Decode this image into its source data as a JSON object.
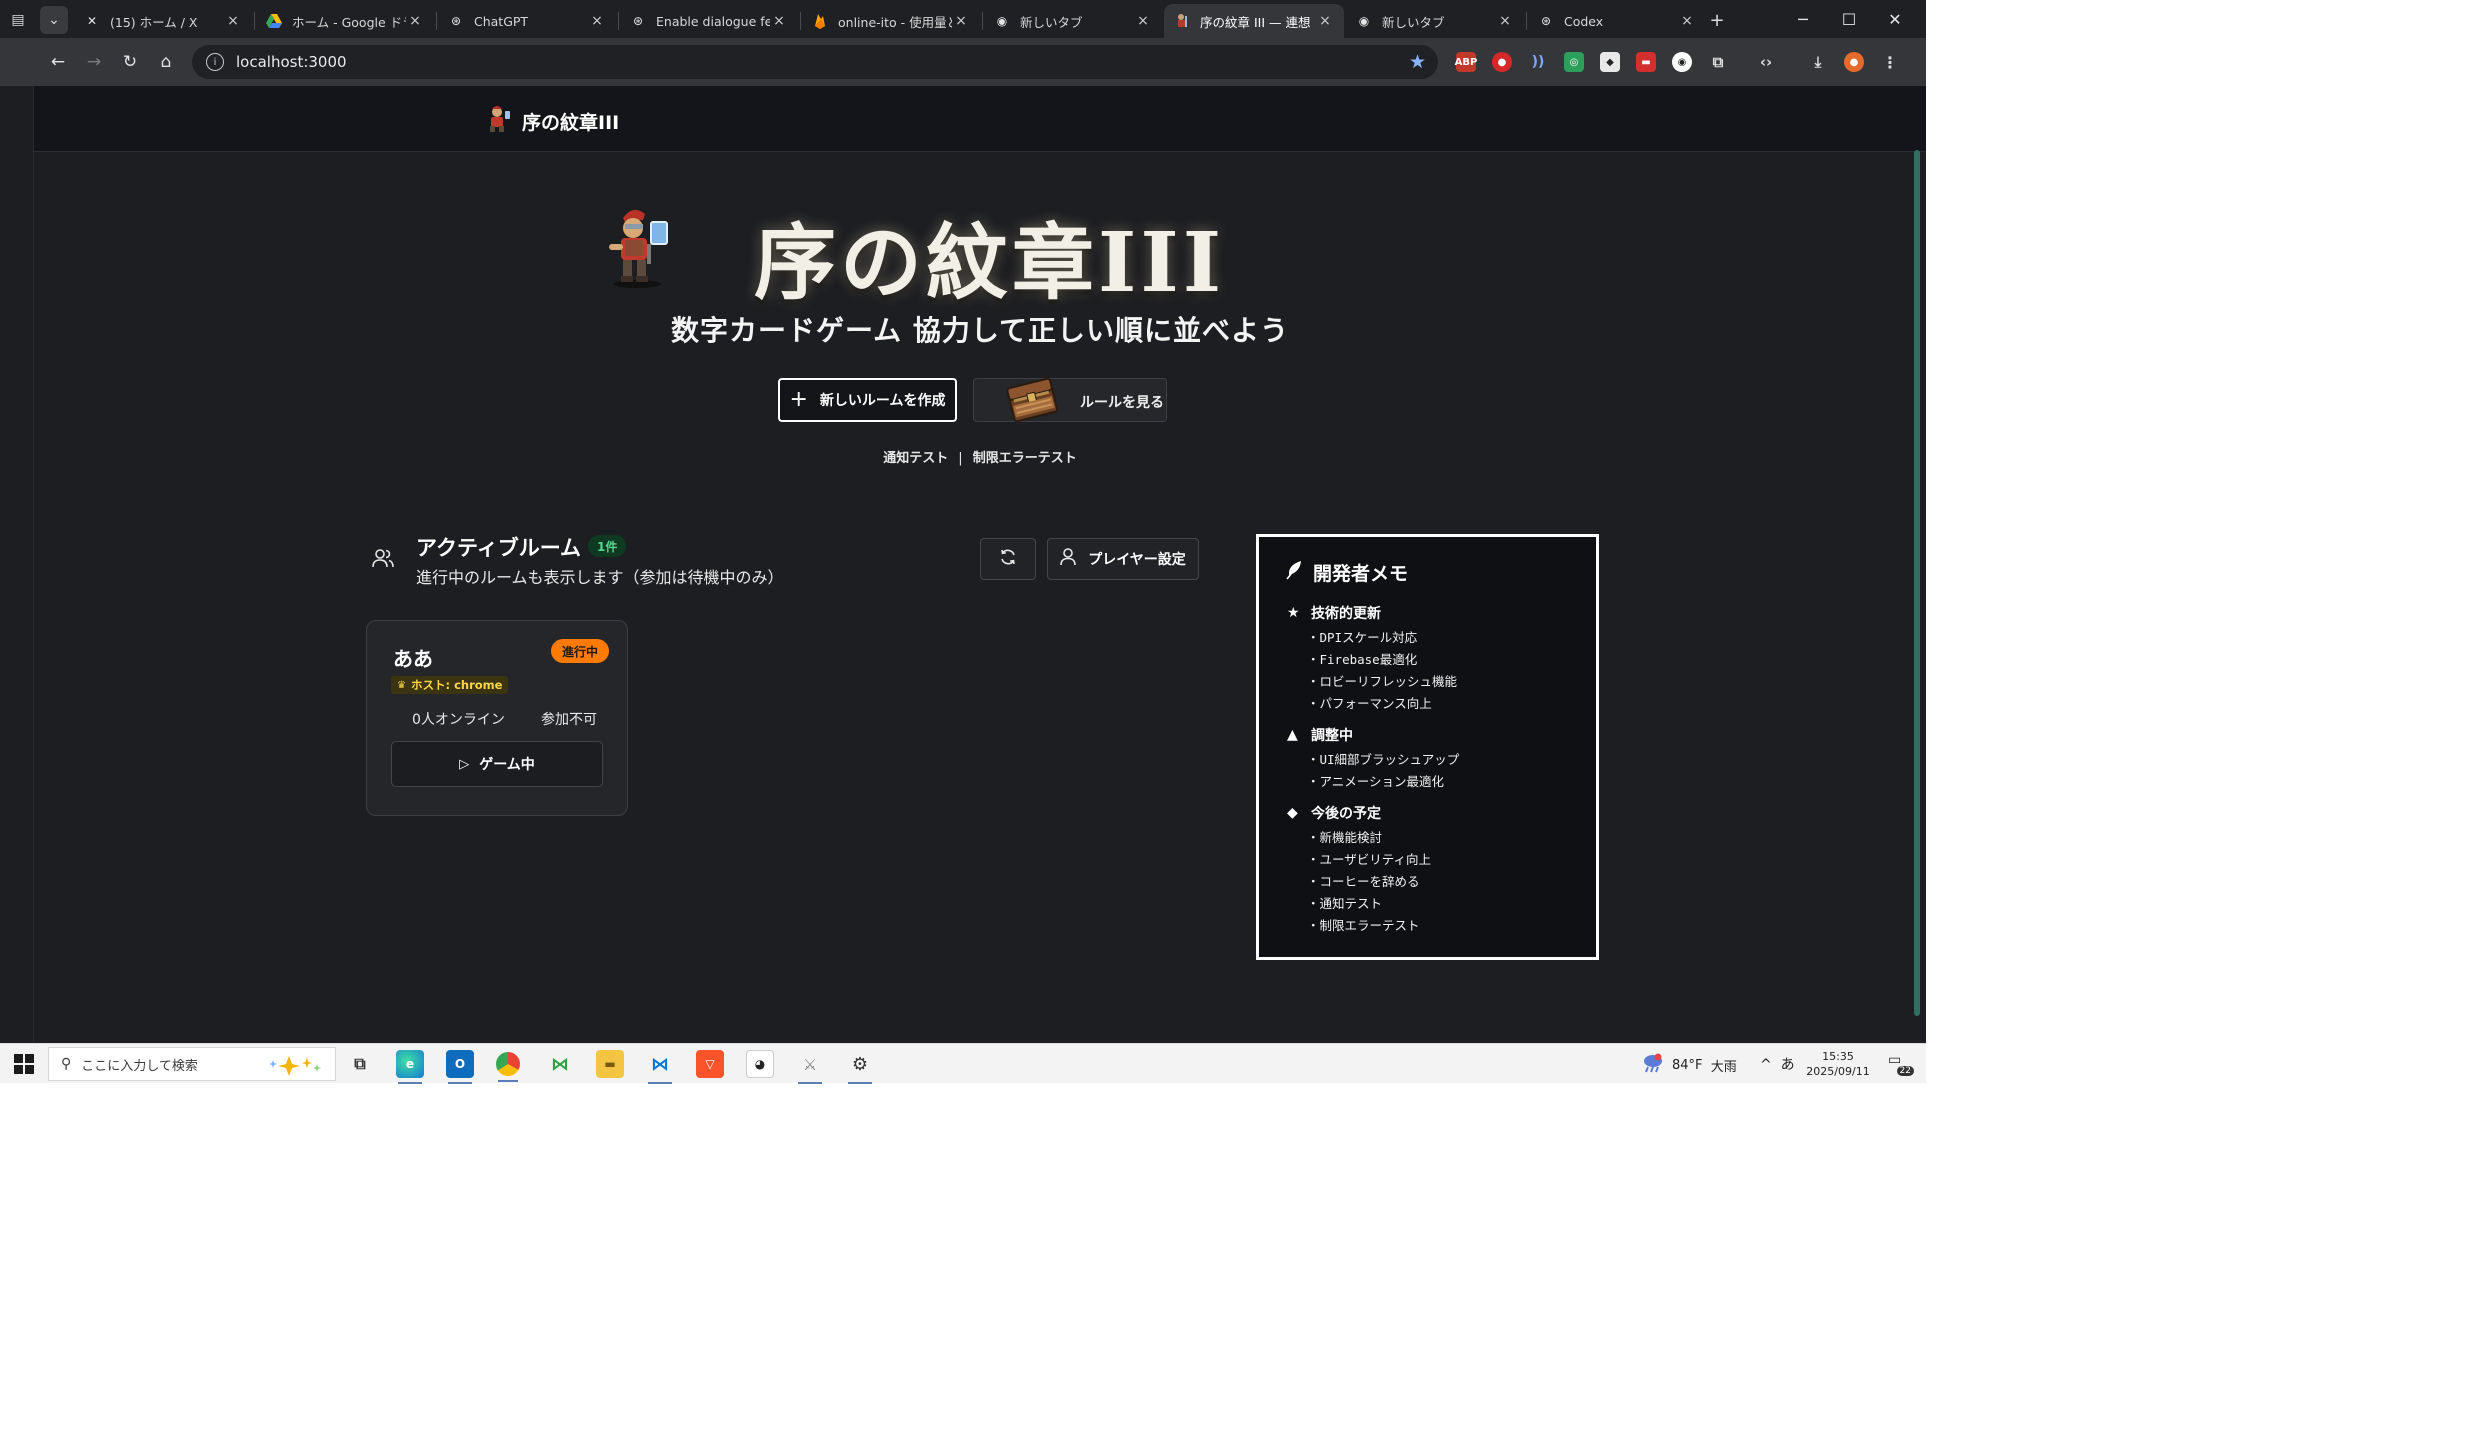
{
  "browser": {
    "tabs": [
      {
        "title": "(15) ホーム / X",
        "icon": "x-logo-icon",
        "active": false
      },
      {
        "title": "ホーム - Google ドライブ",
        "icon": "google-drive-icon",
        "active": false
      },
      {
        "title": "ChatGPT",
        "icon": "chatgpt-icon",
        "active": false
      },
      {
        "title": "Enable dialogue featu",
        "icon": "chatgpt-icon",
        "active": false
      },
      {
        "title": "online-ito - 使用量と",
        "icon": "firebase-icon",
        "active": false
      },
      {
        "title": "新しいタブ",
        "icon": "chrome-icon",
        "active": false
      },
      {
        "title": "序の紋章 III — 連想",
        "icon": "knight-icon",
        "active": true
      },
      {
        "title": "新しいタブ",
        "icon": "chrome-icon",
        "active": false
      },
      {
        "title": "Codex",
        "icon": "chatgpt-icon",
        "active": false
      }
    ],
    "url": "localhost:3000"
  },
  "site": {
    "brand": "序の紋章III",
    "hero_title": "序の紋章III",
    "subtitle": "数字カードゲーム 協力して正しい順に並べよう",
    "create_room_label": "新しいルームを作成",
    "rules_label": "ルールを見る",
    "test_links": [
      "通知テスト",
      "制限エラーテスト"
    ],
    "test_sep": "|"
  },
  "rooms": {
    "title": "アクティブルーム",
    "count": "1件",
    "description": "進行中のルームも表示します（参加は待機中のみ）",
    "player_settings_label": "プレイヤー設定",
    "items": [
      {
        "name": "ああ",
        "status": "進行中",
        "host_prefix": "ホスト:",
        "host": "chrome",
        "online": "0人オンライン",
        "join_state": "参加不可",
        "action_label": "ゲーム中"
      }
    ]
  },
  "dev_memo": {
    "title": "開発者メモ",
    "sections": [
      {
        "symbol": "★",
        "title": "技術的更新",
        "items": [
          "・DPIスケール対応",
          "・Firebase最適化",
          "・ロビーリフレッシュ機能",
          "・パフォーマンス向上"
        ]
      },
      {
        "symbol": "▲",
        "title": "調整中",
        "items": [
          "・UI細部ブラッシュアップ",
          "・アニメーション最適化"
        ]
      },
      {
        "symbol": "◆",
        "title": "今後の予定",
        "items": [
          "・新機能検討",
          "・ユーザビリティ向上",
          "・コーヒーを辞める",
          "・通知テスト",
          "・制限エラーテスト"
        ]
      }
    ]
  },
  "taskbar": {
    "search_placeholder": "ここに入力して検索",
    "temperature": "84°F",
    "weather": "大雨",
    "ime": "あ",
    "time": "15:35",
    "date": "2025/09/11",
    "notifications": "22"
  },
  "colors": {
    "page_bg": "#1d1e21",
    "accent_orange": "#ff7a00",
    "count_green": "#58d68d",
    "host_yellow": "#ffd54a"
  }
}
